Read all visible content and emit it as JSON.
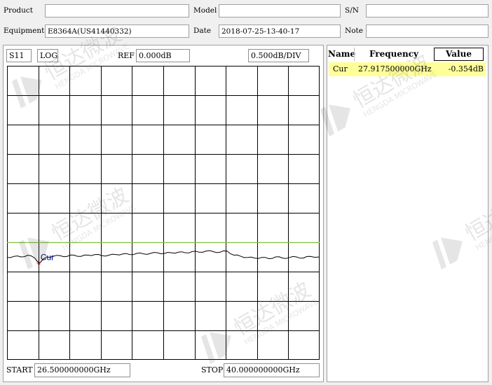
{
  "header": {
    "product_label": "Product",
    "product_value": "",
    "model_label": "Model",
    "model_value": "",
    "sn_label": "S/N",
    "sn_value": "",
    "equipment_label": "Equipment",
    "equipment_value": "E8364A(US41440332)",
    "date_label": "Date",
    "date_value": "2018-07-25-13-40-17",
    "note_label": "Note",
    "note_value": ""
  },
  "chart_header": {
    "param": "S11",
    "format": "LOG",
    "ref_label": "REF",
    "ref_value": "0.000dB",
    "scale": "0.500dB/DIV"
  },
  "chart_footer": {
    "start_label": "START",
    "start_value": "26.500000000GHz",
    "stop_label": "STOP",
    "stop_value": "40.000000000GHz"
  },
  "marker_table": {
    "headers": [
      "Name",
      "Frequency",
      "Value"
    ],
    "rows": [
      {
        "name": "Cur",
        "frequency": "27.917500000GHz",
        "value": "-0.354dB"
      }
    ]
  },
  "chart_data": {
    "type": "line",
    "x_range_ghz": [
      26.5,
      40.0
    ],
    "y_ref_db": 0.0,
    "y_scale_db_per_div": 0.5,
    "divisions_x": 10,
    "divisions_y": 10,
    "reference_line_db": 0.0,
    "reference_line_color": "#80c040",
    "trace_color": "#000000",
    "marker": {
      "label": "Cur",
      "x_ghz": 27.9175,
      "y_db": -0.354,
      "color": "#c00000",
      "label_color": "#000080"
    },
    "series": [
      {
        "x": [
          26.5,
          26.8,
          27.1,
          27.4,
          27.7,
          27.9175,
          28.2,
          28.5,
          28.8,
          29.1,
          29.4,
          29.7,
          30.0,
          30.3,
          30.6,
          30.9,
          31.2,
          31.5,
          31.8,
          32.1,
          32.4,
          32.7,
          33.0,
          33.3,
          33.6,
          33.9,
          34.2,
          34.5,
          34.8,
          35.1,
          35.4,
          35.7,
          36.0,
          36.3,
          36.6,
          36.9,
          37.2,
          37.5,
          37.8,
          38.1,
          38.4,
          38.7,
          39.0,
          39.3,
          39.6,
          40.0
        ],
        "y": [
          -0.26,
          -0.24,
          -0.25,
          -0.22,
          -0.27,
          -0.354,
          -0.25,
          -0.24,
          -0.23,
          -0.24,
          -0.22,
          -0.24,
          -0.22,
          -0.21,
          -0.23,
          -0.22,
          -0.21,
          -0.2,
          -0.21,
          -0.19,
          -0.2,
          -0.19,
          -0.18,
          -0.19,
          -0.18,
          -0.17,
          -0.18,
          -0.16,
          -0.17,
          -0.15,
          -0.16,
          -0.17,
          -0.15,
          -0.22,
          -0.24,
          -0.26,
          -0.27,
          -0.26,
          -0.28,
          -0.25,
          -0.27,
          -0.26,
          -0.25,
          -0.27,
          -0.24,
          -0.25
        ]
      }
    ]
  },
  "watermark": {
    "text_cn": "恒达微波",
    "text_en": "HENGDA MICROWAVE"
  }
}
